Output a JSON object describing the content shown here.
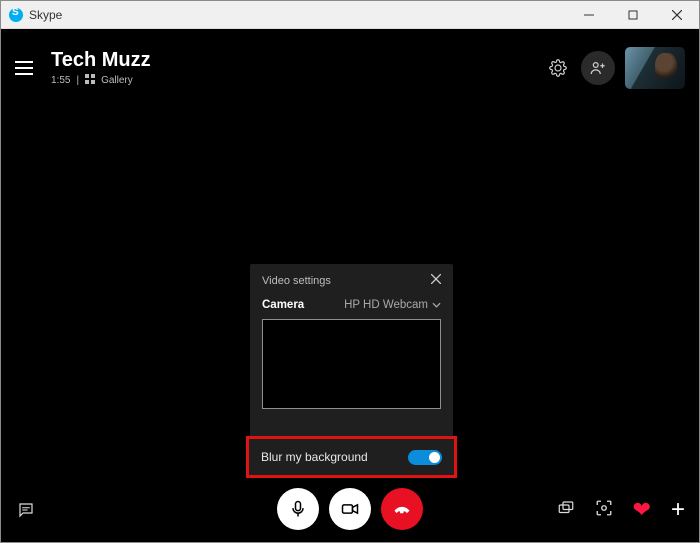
{
  "window": {
    "title": "Skype"
  },
  "header": {
    "contact_name": "Tech Muzz",
    "call_time": "1:55",
    "sub_separator": "|",
    "gallery_label": "Gallery"
  },
  "video_settings": {
    "title": "Video settings",
    "camera_label": "Camera",
    "camera_selected": "HP HD Webcam",
    "blur_label": "Blur my background",
    "blur_enabled": true
  },
  "icons": {
    "gear": "gear",
    "add_person": "add-person",
    "chat": "chat",
    "mic": "mic",
    "video": "video",
    "hangup": "hangup",
    "screen_share": "screen-share",
    "snapshot": "snapshot",
    "heart": "heart",
    "plus": "plus"
  }
}
